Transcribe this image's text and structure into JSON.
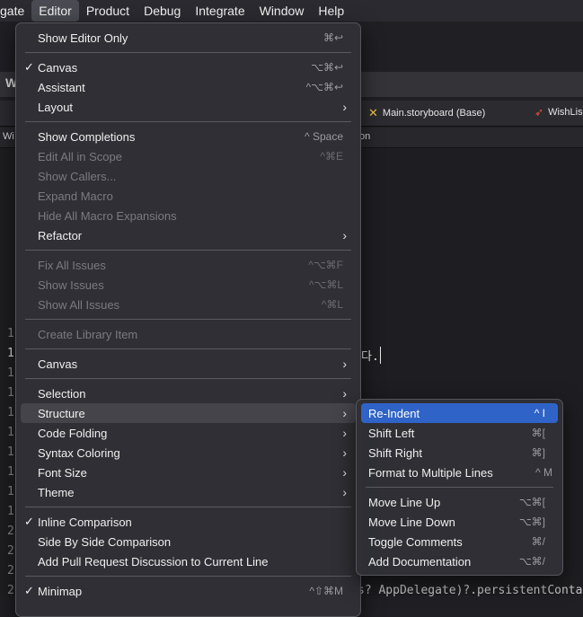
{
  "menubar": {
    "items": [
      {
        "label": "gate"
      },
      {
        "label": "Editor"
      },
      {
        "label": "Product"
      },
      {
        "label": "Debug"
      },
      {
        "label": "Integrate"
      },
      {
        "label": "Window"
      },
      {
        "label": "Help"
      }
    ]
  },
  "background": {
    "window_title_char": "W",
    "tabs": [
      {
        "label": "Main.storyboard (Base)"
      },
      {
        "label": "WishLis"
      }
    ],
    "jump_left": "Wi",
    "jump_right": "on",
    "line_numbers": [
      "1",
      "1",
      "1",
      "1",
      "1",
      "1",
      "1",
      "1",
      "1",
      "1",
      "2",
      "2",
      "2",
      "2"
    ],
    "code_korean": "다.",
    "code_last_line": "s? AppDelegate)?.persistentConta"
  },
  "editor_menu": {
    "items": [
      {
        "label": "Show Editor Only",
        "shortcut": "⌘↩"
      },
      {
        "label": "Canvas",
        "shortcut": "⌥⌘↩",
        "checked": "✓"
      },
      {
        "label": "Assistant",
        "shortcut": "^⌥⌘↩"
      },
      {
        "label": "Layout"
      },
      {
        "label": "Show Completions",
        "shortcut": "^ Space"
      },
      {
        "label": "Edit All in Scope",
        "shortcut": "^⌘E"
      },
      {
        "label": "Show Callers..."
      },
      {
        "label": "Expand Macro"
      },
      {
        "label": "Hide All Macro Expansions"
      },
      {
        "label": "Refactor"
      },
      {
        "label": "Fix All Issues",
        "shortcut": "^⌥⌘F"
      },
      {
        "label": "Show Issues",
        "shortcut": "^⌥⌘L"
      },
      {
        "label": "Show All Issues",
        "shortcut": "^⌘L"
      },
      {
        "label": "Create Library Item"
      },
      {
        "label": "Canvas"
      },
      {
        "label": "Selection"
      },
      {
        "label": "Structure"
      },
      {
        "label": "Code Folding"
      },
      {
        "label": "Syntax Coloring"
      },
      {
        "label": "Font Size"
      },
      {
        "label": "Theme"
      },
      {
        "label": "Inline Comparison",
        "checked": "✓"
      },
      {
        "label": "Side By Side Comparison"
      },
      {
        "label": "Add Pull Request Discussion to Current Line"
      },
      {
        "label": "Minimap",
        "shortcut": "^⇧⌘M",
        "checked": "✓"
      }
    ],
    "submenu_arrow": "›"
  },
  "structure_submenu": {
    "items": [
      {
        "label": "Re-Indent",
        "shortcut": "^ I"
      },
      {
        "label": "Shift Left",
        "shortcut": "⌘["
      },
      {
        "label": "Shift Right",
        "shortcut": "⌘]"
      },
      {
        "label": "Format to Multiple Lines",
        "shortcut": "^ M"
      },
      {
        "label": "Move Line Up",
        "shortcut": "⌥⌘["
      },
      {
        "label": "Move Line Down",
        "shortcut": "⌥⌘]"
      },
      {
        "label": "Toggle Comments",
        "shortcut": "⌘/"
      },
      {
        "label": "Add Documentation",
        "shortcut": "⌥⌘/"
      }
    ]
  },
  "colors": {
    "selection": "#2f63c7",
    "swift_orange": "#f05138",
    "storyboard_yellow": "#f5c542"
  }
}
